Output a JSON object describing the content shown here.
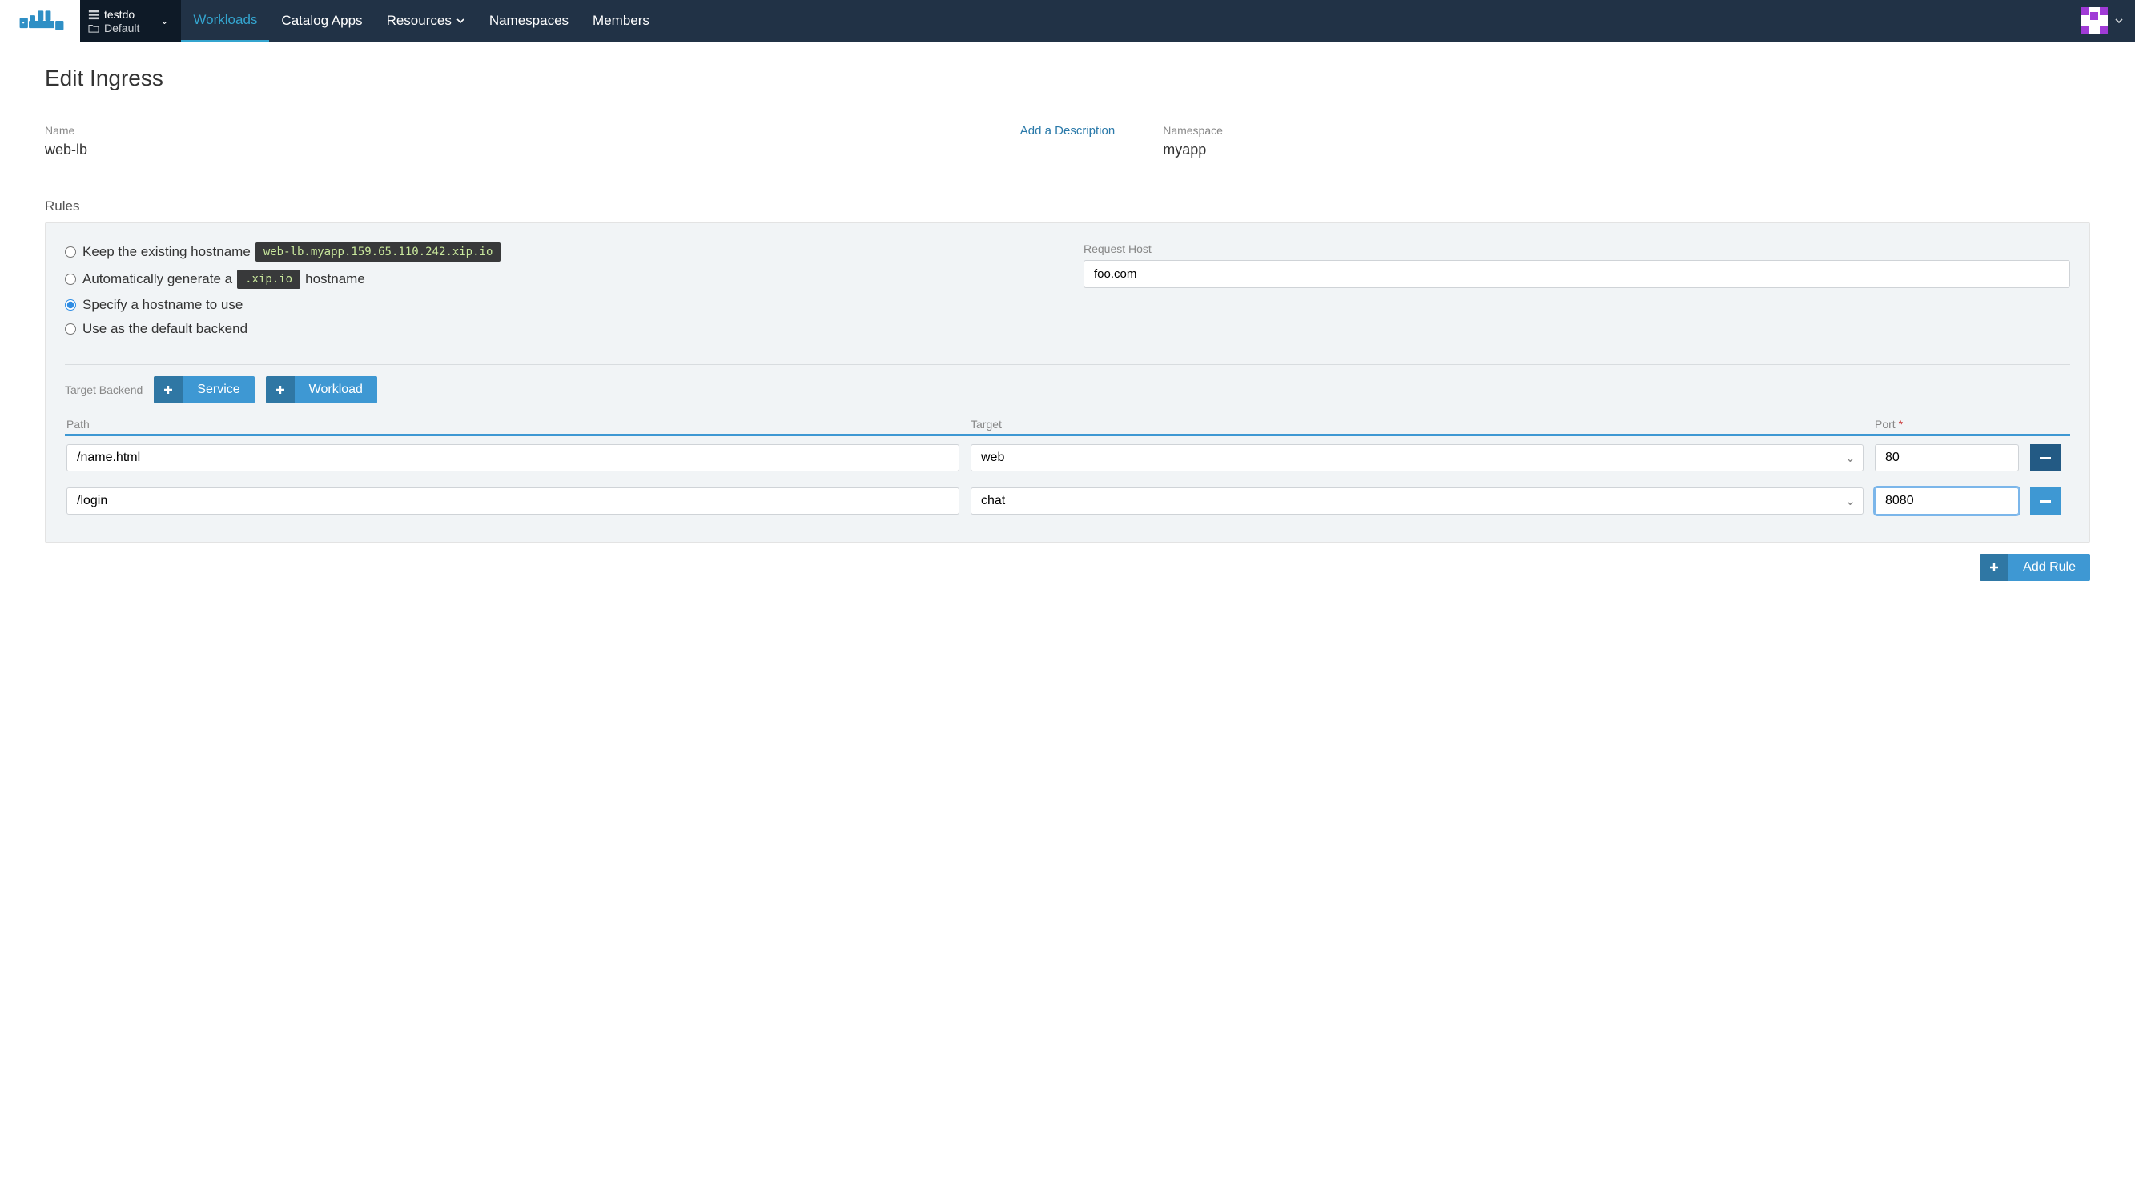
{
  "nav": {
    "project": "testdo",
    "namespace_scope": "Default",
    "items": [
      "Workloads",
      "Catalog Apps",
      "Resources",
      "Namespaces",
      "Members"
    ],
    "active_index": 0
  },
  "page": {
    "title": "Edit Ingress",
    "name_label": "Name",
    "name_value": "web-lb",
    "desc_link": "Add a Description",
    "ns_label": "Namespace",
    "ns_value": "myapp",
    "rules_label": "Rules"
  },
  "rule": {
    "radios": {
      "keep": "Keep the existing hostname",
      "keep_code": "web-lb.myapp.159.65.110.242.xip.io",
      "auto_pre": "Automatically generate a",
      "auto_code": ".xip.io",
      "auto_post": "hostname",
      "specify": "Specify a hostname to use",
      "default": "Use as the default backend",
      "selected": "specify"
    },
    "request_host_label": "Request Host",
    "request_host_value": "foo.com",
    "target_backend_label": "Target Backend",
    "service_btn": "Service",
    "workload_btn": "Workload",
    "table": {
      "head_path": "Path",
      "head_target": "Target",
      "head_port": "Port",
      "rows": [
        {
          "path": "/name.html",
          "target": "web",
          "port": "80",
          "focused": false
        },
        {
          "path": "/login",
          "target": "chat",
          "port": "8080",
          "focused": true
        }
      ]
    },
    "add_rule": "Add Rule"
  }
}
